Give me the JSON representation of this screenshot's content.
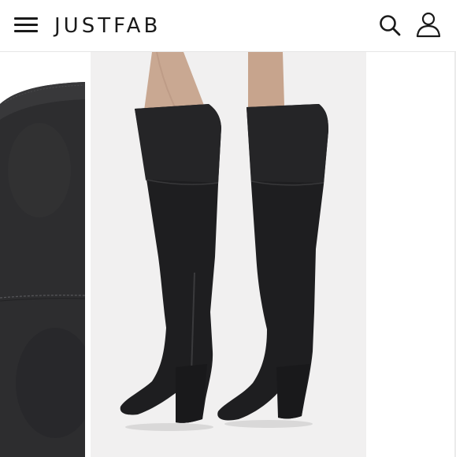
{
  "header": {
    "logo_text": "JUSTFAB",
    "icons": {
      "menu": "hamburger-menu-icon",
      "search": "search-icon",
      "account": "user-icon"
    }
  },
  "gallery": {
    "images": [
      {
        "name": "boot-suede-detail-closeup",
        "role": "previous-thumbnail"
      },
      {
        "name": "black-suede-over-the-knee-boots-on-model",
        "role": "main-image"
      }
    ]
  },
  "colors": {
    "accent": "#1a1a1a",
    "boot": "#1e1e20",
    "background": "#ffffff",
    "image_backdrop": "#f1f0f0"
  }
}
